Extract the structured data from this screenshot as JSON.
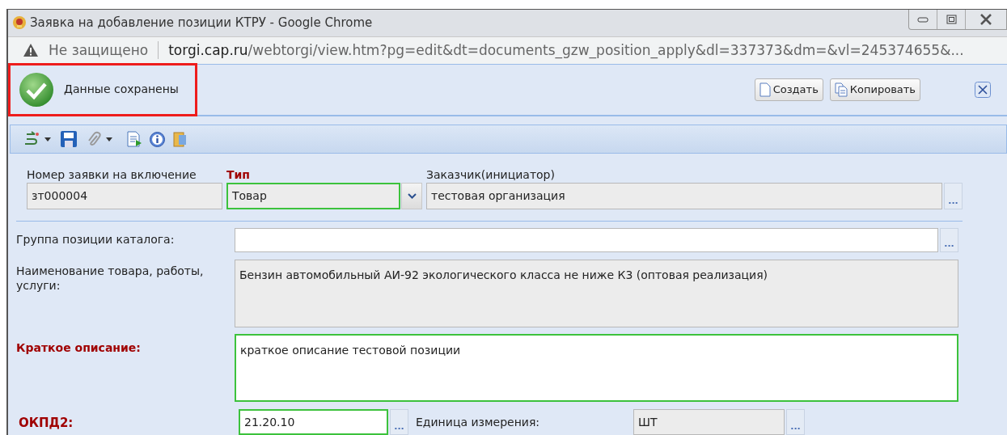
{
  "window": {
    "title": "Заявка на добавление позиции КТРУ - Google Chrome"
  },
  "address_bar": {
    "security": "Не защищено",
    "url_host": "torgi.cap.ru",
    "url_path": "/webtorgi/view.htm?pg=edit&dt=documents_gzw_position_apply&dl=337373&dm=&vl=245374655&..."
  },
  "notification": {
    "message": "Данные сохранены",
    "highlighted": true
  },
  "header_buttons": [
    {
      "label": "Создать",
      "kind": "new"
    },
    {
      "label": "Копировать",
      "kind": "copy"
    }
  ],
  "form": {
    "fields": [
      {
        "label": "Номер заявки на включение",
        "required": false,
        "value": "зт000004",
        "readonly": true,
        "validated": false
      },
      {
        "label": "Тип",
        "required": true,
        "value": "Товар",
        "readonly": true,
        "validated": true,
        "dropdown": true
      },
      {
        "label": "Заказчик(инициатор)",
        "required": false,
        "value": "тестовая организация",
        "readonly": true,
        "validated": false,
        "picker": "..."
      },
      {
        "label": "Группа позиции каталога:",
        "required": false,
        "readonly": false,
        "validated": false,
        "picker": "..."
      },
      {
        "label": "Наименование товара, работы, услуги:",
        "required": false,
        "value": "Бензин автомобильный АИ-92 экологического класса не ниже К3 (оптовая реализация)",
        "readonly": true,
        "validated": false
      },
      {
        "label": "Краткое описание:",
        "required": true,
        "value": "краткое описание тестовой позиции",
        "readonly": false,
        "validated": true
      },
      {
        "label": "ОКПД2:",
        "required": true,
        "value": "21.20.10",
        "readonly": false,
        "validated": true,
        "picker": "..."
      },
      {
        "label": "Единица измерения:",
        "required": false,
        "value": "ШТ",
        "readonly": true,
        "validated": false,
        "picker": "..."
      }
    ]
  }
}
